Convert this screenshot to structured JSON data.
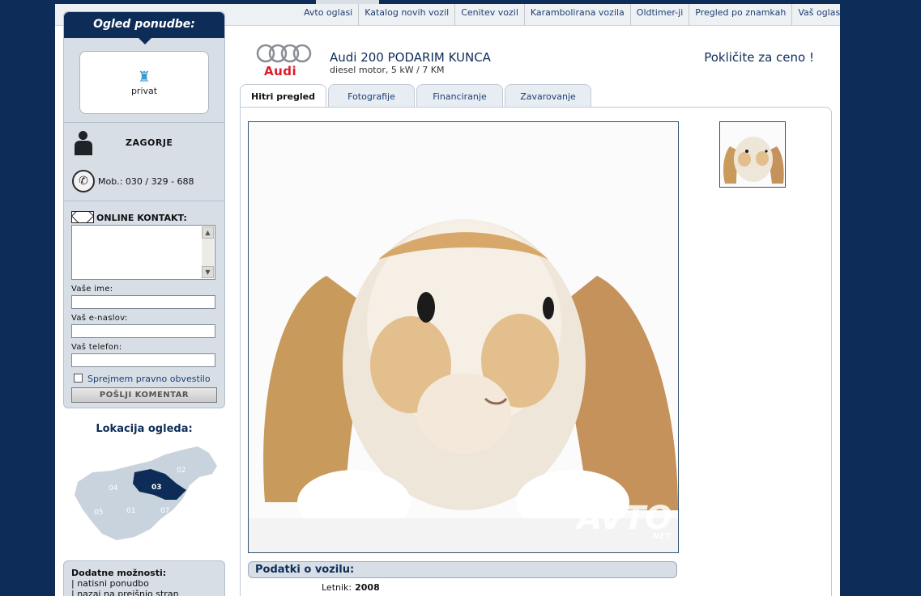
{
  "topnav": {
    "items": [
      "Avto oglasi",
      "Katalog novih vozil",
      "Cenitev vozil",
      "Karambolirana vozila",
      "Oldtimer-ji",
      "Pregled po znamkah",
      "Vaš oglas"
    ]
  },
  "sidebar": {
    "heading": "Ogled ponudbe:",
    "seller_type": "privat",
    "seller_name": "ZAGORJE",
    "phone": "Mob.: 030 / 329 - 688",
    "contact": {
      "title": "ONLINE KONTAKT:",
      "name_label": "Vaše ime:",
      "email_label": "Vaš e-naslov:",
      "phone_label": "Vaš telefon:",
      "legal_label": "Sprejmem pravno obvestilo",
      "send_button": "POŠLJI KOMENTAR"
    },
    "location": {
      "title": "Lokacija ogleda:",
      "regions": [
        "02",
        "03",
        "04",
        "05",
        "01",
        "07"
      ],
      "selected": "03"
    },
    "extra": {
      "title": "Dodatne možnosti:",
      "links": [
        "| natisni ponudbo",
        "| nazaj na prejšnjo stran"
      ]
    }
  },
  "listing": {
    "brand": "Audi",
    "title": "Audi 200 PODARIM KUNCA",
    "subtitle": "diesel motor,  5 kW / 7 KM",
    "price": "Pokličite za ceno !",
    "tabs": [
      "Hitri pregled",
      "Fotografije",
      "Financiranje",
      "Zavarovanje"
    ],
    "active_tab": "Hitri pregled",
    "watermark": "AVTO",
    "watermark_sub": "NET",
    "details_title": "Podatki o vozilu:",
    "details": [
      {
        "label": "Letnik:",
        "value": "2008"
      }
    ]
  },
  "colors": {
    "navy": "#0d2d58",
    "panel_gray": "#d7dee6",
    "audi_red": "#d81e2c"
  }
}
